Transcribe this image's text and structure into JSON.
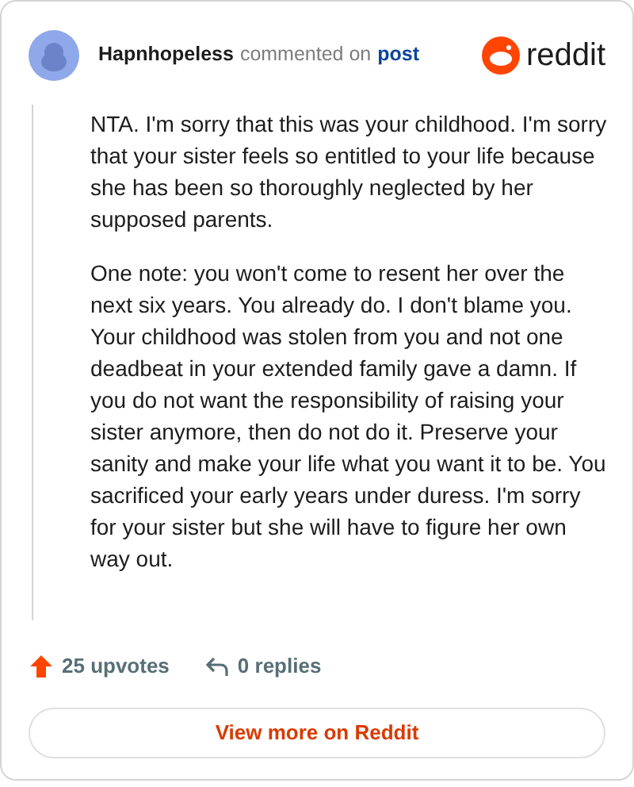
{
  "header": {
    "author": "Hapnhopeless",
    "action": "commented on",
    "link": "post",
    "brand": "reddit"
  },
  "comment": {
    "paragraphs": [
      "NTA. I'm sorry that this was your childhood. I'm sorry that your sister feels so entitled to your life because she has been so thoroughly neglected by her supposed parents.",
      "One note: you won't come to resent her over the next six years. You already do. I don't blame you. Your childhood was stolen from you and not one deadbeat in your extended family gave a damn. If you do not want the responsibility of raising your sister anymore, then do not do it. Preserve your sanity and make your life what you want it to be. You sacrificed your early years under duress. I'm sorry for your sister but she will have to figure her own way out."
    ]
  },
  "stats": {
    "upvotes": "25 upvotes",
    "replies": "0 replies"
  },
  "button": "View more on Reddit"
}
